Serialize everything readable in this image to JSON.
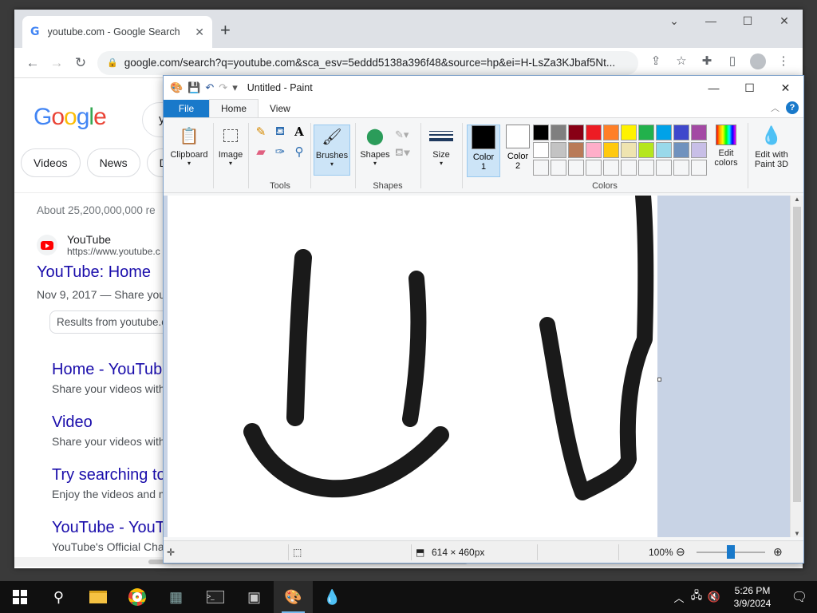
{
  "chrome": {
    "tab_title": "youtube.com - Google Search",
    "url": "google.com/search?q=youtube.com&sca_esv=5eddd5138a396f48&source=hp&ei=H-LsZa3KJbaf5Nt..."
  },
  "google": {
    "search_query": "y",
    "chips": [
      "Videos",
      "News",
      "Do"
    ],
    "result_stats": "About 25,200,000,000 re",
    "top_result": {
      "site_name": "YouTube",
      "site_url": "https://www.youtube.c",
      "title": "YouTube: Home",
      "date_snippet": "Nov 9, 2017 — Share you",
      "results_from": "Results from youtube.c"
    },
    "sub_results": [
      {
        "title": "Home - YouTub",
        "desc": "Share your videos with"
      },
      {
        "title": "Video",
        "desc": "Share your videos with"
      },
      {
        "title": "Try searching to",
        "desc": "Enjoy the videos and m"
      },
      {
        "title": "YouTube - YouT",
        "desc": "YouTube's Official Cha"
      }
    ]
  },
  "paint": {
    "window_title": "Untitled - Paint",
    "tabs": {
      "file": "File",
      "home": "Home",
      "view": "View"
    },
    "ribbon": {
      "clipboard": "Clipboard",
      "image": "Image",
      "tools_group": "Tools",
      "brushes": "Brushes",
      "shapes": "Shapes",
      "shapes_group": "Shapes",
      "size": "Size",
      "color1_a": "Color",
      "color1_b": "1",
      "color2_a": "Color",
      "color2_b": "2",
      "colors_group": "Colors",
      "edit_colors_a": "Edit",
      "edit_colors_b": "colors",
      "paint3d_a": "Edit with",
      "paint3d_b": "Paint 3D"
    },
    "palette": [
      "#000000",
      "#7f7f7f",
      "#880015",
      "#ed1c24",
      "#ff7f27",
      "#fff200",
      "#22b14c",
      "#00a2e8",
      "#3f48cc",
      "#a349a4",
      "#ffffff",
      "#c3c3c3",
      "#b97a57",
      "#ffaec9",
      "#ffc90e",
      "#efe4b0",
      "#b5e61d",
      "#99d9ea",
      "#7092be",
      "#c8bfe7",
      "#f5f6f7",
      "#f5f6f7",
      "#f5f6f7",
      "#f5f6f7",
      "#f5f6f7",
      "#f5f6f7",
      "#f5f6f7",
      "#f5f6f7",
      "#f5f6f7",
      "#f5f6f7"
    ],
    "color1": "#000000",
    "color2": "#ffffff",
    "status": {
      "canvas_size": "614 × 460px",
      "zoom": "100%"
    }
  },
  "taskbar": {
    "time": "5:26 PM",
    "date": "3/9/2024"
  }
}
